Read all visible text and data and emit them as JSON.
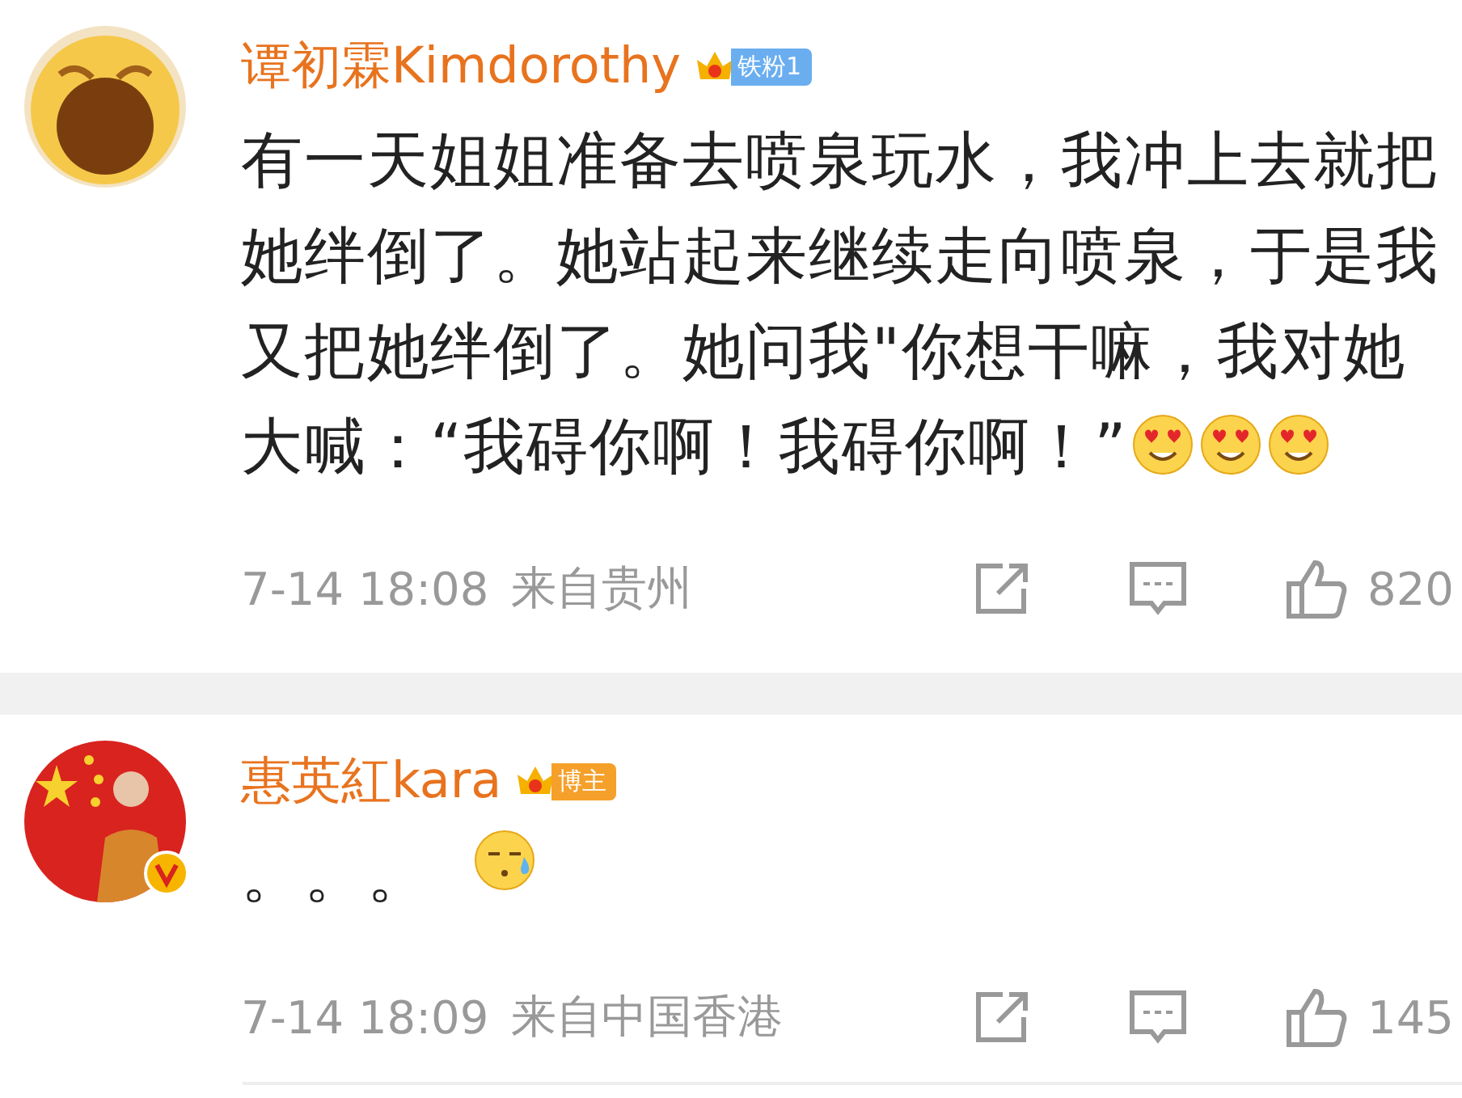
{
  "comments": [
    {
      "avatar": {
        "kind": "picture"
      },
      "author": "谭初霖Kimdorothy",
      "verified": false,
      "badge": {
        "label": "铁粉1",
        "color": "#6aaef0"
      },
      "text": "有一天姐姐准备去喷泉玩水，我冲上去就把她绊倒了。她站起来继续走向喷泉，于是我又把她绊倒了。她问我\"你想干嘛，我对她大喊：“我碍你啊！我碍你啊！”",
      "emojis": [
        {
          "kind": "heart-eyes"
        },
        {
          "kind": "heart-eyes"
        },
        {
          "kind": "heart-eyes"
        }
      ],
      "time": "7-14 18:08",
      "location": "来自贵州",
      "likes": "820"
    },
    {
      "avatar": {
        "kind": "picture"
      },
      "author": "惠英紅kara",
      "verified": true,
      "badge": {
        "label": "博主",
        "color": "#f5a02a"
      },
      "text": "。。。",
      "emojis": [
        {
          "kind": "sweat"
        }
      ],
      "time": "7-14 18:09",
      "location": "来自中国香港",
      "likes": "145"
    }
  ]
}
